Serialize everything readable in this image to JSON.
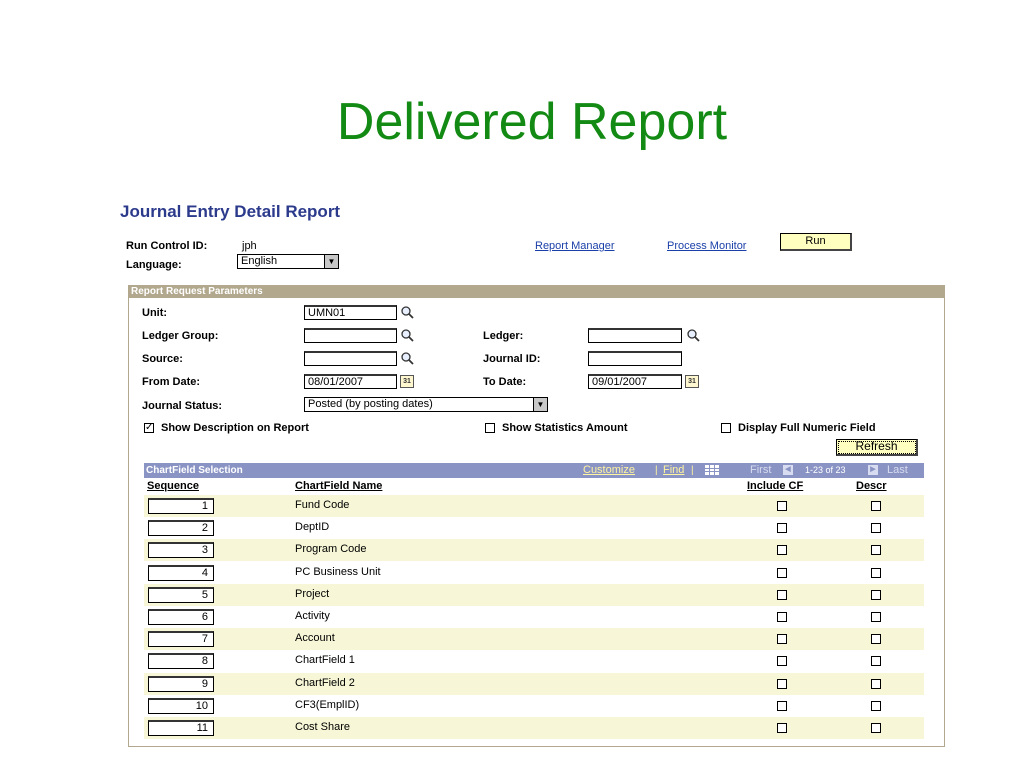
{
  "slide_title": "Delivered Report",
  "page_title": "Journal Entry Detail Report",
  "run_control": {
    "label": "Run Control ID:",
    "value": "jph"
  },
  "language": {
    "label": "Language:",
    "value": "English"
  },
  "links": {
    "report_manager": "Report Manager",
    "process_monitor": "Process Monitor"
  },
  "run_button": "Run",
  "params": {
    "header": "Report Request Parameters",
    "unit": {
      "label": "Unit:",
      "value": "UMN01"
    },
    "ledger_group": {
      "label": "Ledger Group:",
      "value": ""
    },
    "ledger": {
      "label": "Ledger:",
      "value": ""
    },
    "source": {
      "label": "Source:",
      "value": ""
    },
    "journal_id": {
      "label": "Journal ID:",
      "value": ""
    },
    "from_date": {
      "label": "From Date:",
      "value": "08/01/2007"
    },
    "to_date": {
      "label": "To Date:",
      "value": "09/01/2007"
    },
    "journal_status": {
      "label": "Journal Status:",
      "value": "Posted (by posting dates)"
    },
    "show_description": {
      "label": "Show Description on Report",
      "checked": true
    },
    "show_statistics": {
      "label": "Show Statistics Amount",
      "checked": false
    },
    "display_full_numeric": {
      "label": "Display Full Numeric Field",
      "checked": false
    },
    "refresh_button": "Refresh",
    "calendar_icon_text": "31"
  },
  "grid": {
    "title": "ChartField Selection",
    "customize": "Customize",
    "find": "Find",
    "sep": "|",
    "first": "First",
    "range": "1-23 of 23",
    "last": "Last",
    "columns": {
      "sequence": "Sequence",
      "chartfield_name": "ChartField Name",
      "include_cf": "Include CF",
      "descr": "Descr"
    },
    "rows": [
      {
        "seq": "1",
        "name": "Fund Code"
      },
      {
        "seq": "2",
        "name": "DeptID"
      },
      {
        "seq": "3",
        "name": "Program Code"
      },
      {
        "seq": "4",
        "name": "PC Business Unit"
      },
      {
        "seq": "5",
        "name": "Project"
      },
      {
        "seq": "6",
        "name": "Activity"
      },
      {
        "seq": "7",
        "name": "Account"
      },
      {
        "seq": "8",
        "name": "ChartField 1"
      },
      {
        "seq": "9",
        "name": "ChartField 2"
      },
      {
        "seq": "10",
        "name": "CF3(EmplID)"
      },
      {
        "seq": "11",
        "name": "Cost Share"
      }
    ]
  },
  "colors": {
    "title_green": "#138a13",
    "page_title_blue": "#2c3a8c",
    "panel_tan": "#b2a88e",
    "grid_header": "#8a94c4",
    "button_yellow": "#ffffc0"
  }
}
